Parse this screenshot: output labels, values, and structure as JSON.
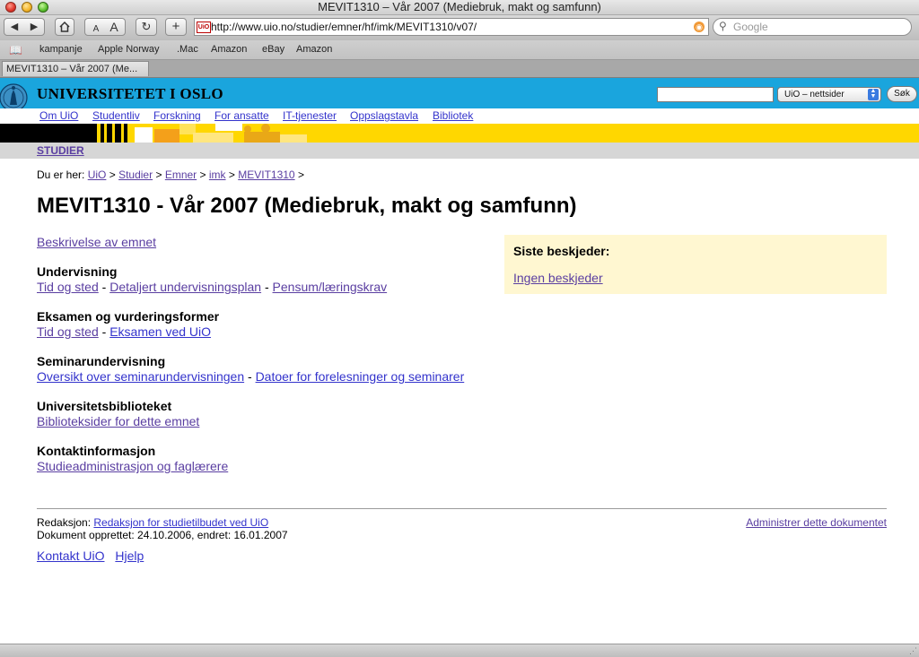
{
  "browser": {
    "window_title": "MEVIT1310 – Vår 2007 (Mediebruk, makt og samfunn)",
    "url": "http://www.uio.no/studier/emner/hf/imk/MEVIT1310/v07/",
    "search_placeholder": "Google",
    "font_small": "A",
    "font_large": "A",
    "favicon_text": "UiO",
    "bookmarks": [
      "kampanje",
      "Apple Norway",
      ".Mac",
      "Amazon",
      "eBay",
      "Amazon"
    ],
    "tab_label": "MEVIT1310 – Vår 2007 (Me..."
  },
  "site": {
    "name": "UNIVERSITETET I OSLO",
    "search_scope": "UiO – nettsider",
    "search_button": "Søk",
    "nav": [
      "Om UiO",
      "Studentliv",
      "Forskning",
      "For ansatte",
      "IT-tjenester",
      "Oppslagstavla",
      "Bibliotek"
    ],
    "section": "STUDIER"
  },
  "breadcrumb": {
    "prefix": "Du er her:",
    "items": [
      "UiO",
      "Studier",
      "Emner",
      "imk",
      "MEVIT1310"
    ],
    "sep": ">"
  },
  "page": {
    "title": "MEVIT1310 - Vår 2007 (Mediebruk, makt og samfunn)",
    "description_link": "Beskrivelse av emnet",
    "sections": [
      {
        "heading": "Undervisning",
        "links": [
          "Tid og sted",
          "Detaljert undervisningsplan",
          "Pensum/læringskrav"
        ]
      },
      {
        "heading": "Eksamen og vurderingsformer",
        "links": [
          "Tid og sted",
          "Eksamen ved UiO"
        ]
      },
      {
        "heading": "Seminarundervisning",
        "links": [
          "Oversikt over seminarundervisningen",
          "Datoer for forelesninger og seminarer"
        ]
      },
      {
        "heading": "Universitetsbiblioteket",
        "links": [
          "Biblioteksider for dette emnet"
        ]
      },
      {
        "heading": "Kontaktinformasjon",
        "links": [
          "Studieadministrasjon og faglærere"
        ]
      }
    ],
    "link_separator": "-"
  },
  "messages": {
    "heading": "Siste beskjeder:",
    "link": "Ingen beskjeder"
  },
  "footer": {
    "redaksjon_label": "Redaksjon:",
    "redaksjon_link": "Redaksjon for studietilbudet ved UiO",
    "dates": "Dokument opprettet: 24.10.2006, endret: 16.01.2007",
    "admin_link": "Administrer dette dokumentet",
    "links": [
      "Kontakt UiO",
      "Hjelp"
    ]
  },
  "colors": {
    "header_blue": "#1aa5dd",
    "banner_yellow": "#ffd700",
    "visited_link": "#5a3ea1",
    "link": "#3333cc",
    "messages_bg": "#fff7d1"
  }
}
